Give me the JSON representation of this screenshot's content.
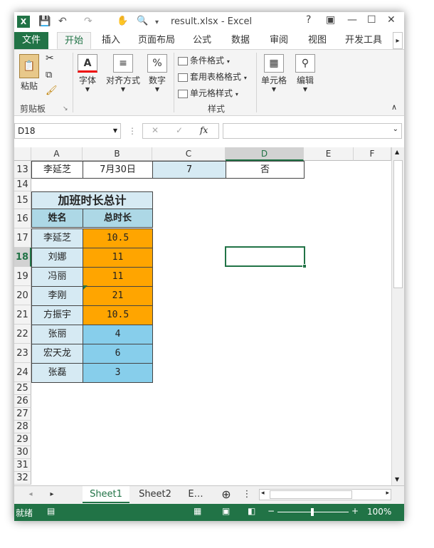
{
  "app": {
    "title": "result.xlsx - Excel",
    "logo": "X",
    "help": "?",
    "controls": {
      "help": "?",
      "ribbon_display": "▣",
      "minimize": "—",
      "restore": "☐",
      "close": "✕"
    }
  },
  "ribbon_tabs": [
    "文件",
    "开始",
    "插入",
    "页面布局",
    "公式",
    "数据",
    "审阅",
    "视图",
    "开发工具"
  ],
  "active_tab": "开始",
  "ribbon": {
    "paste": "粘贴",
    "clipboard_group": "剪贴板",
    "font": "字体",
    "alignment": "对齐方式",
    "number": "数字",
    "conditional_format": "条件格式",
    "table_format": "套用表格格式",
    "cell_style": "单元格样式",
    "styles_group": "样式",
    "cells": "单元格",
    "editing": "编辑",
    "number_icon": "%",
    "font_icon": "A"
  },
  "formula_bar": {
    "name_box": "D18",
    "cancel": "✕",
    "enter": "✓",
    "fx": "fx",
    "value": ""
  },
  "columns": [
    "A",
    "B",
    "C",
    "D",
    "E",
    "F"
  ],
  "selected_column": "D",
  "selected_row": "18",
  "rows": [
    "13",
    "14",
    "15",
    "16",
    "17",
    "18",
    "19",
    "20",
    "21",
    "22",
    "23",
    "24",
    "25",
    "26",
    "27",
    "28",
    "29",
    "30",
    "31",
    "32"
  ],
  "row13": {
    "a": "李延芝",
    "b": "7月30日",
    "c": "7",
    "d": "否"
  },
  "table": {
    "title": "加班时长总计",
    "header_name": "姓名",
    "header_total": "总时长",
    "rows": [
      {
        "name": "李延芝",
        "total": "10.5",
        "color": "#ffa500"
      },
      {
        "name": "刘娜",
        "total": "11",
        "color": "#ffa500"
      },
      {
        "name": "冯丽",
        "total": "11",
        "color": "#ffa500"
      },
      {
        "name": "李刚",
        "total": "21",
        "color": "#ffa500"
      },
      {
        "name": "方振宇",
        "total": "10.5",
        "color": "#ffa500"
      },
      {
        "name": "张丽",
        "total": "4",
        "color": "#87ceeb"
      },
      {
        "name": "宏天龙",
        "total": "6",
        "color": "#87ceeb"
      },
      {
        "name": "张磊",
        "total": "3",
        "color": "#87ceeb"
      }
    ],
    "name_bg": "#d6eaf3",
    "header_bg": "#add8e6"
  },
  "sheets": [
    "Sheet1",
    "Sheet2",
    "E…"
  ],
  "active_sheet": "Sheet1",
  "status": {
    "ready": "就绪",
    "zoom": "100%"
  },
  "colors": {
    "accent": "#217346",
    "orange": "#ffa500",
    "blue": "#87ceeb"
  }
}
